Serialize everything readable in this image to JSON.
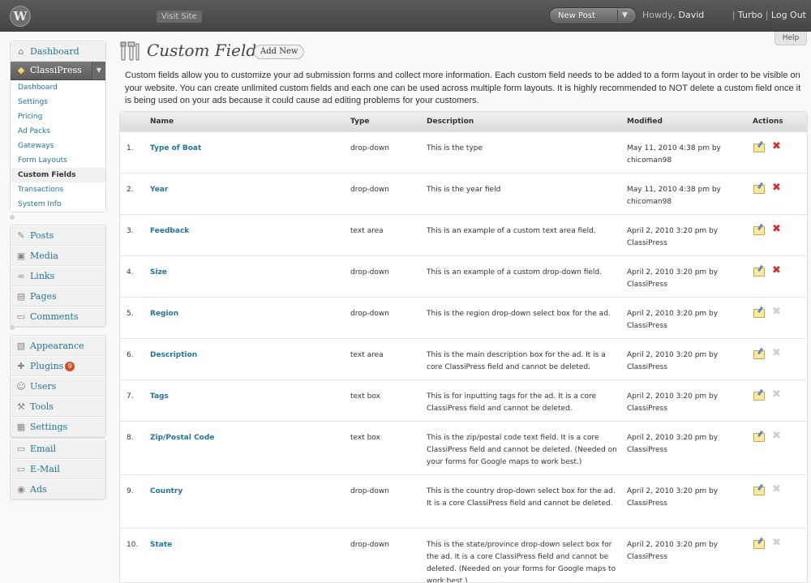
{
  "topbar": {
    "logo": "W",
    "visit_site": "Visit Site",
    "new_post": "New Post",
    "dropdown_arrow": "▼",
    "howdy_prefix": "Howdy, ",
    "user": "David",
    "turbo": "Turbo",
    "separator": "|",
    "logout": "Log Out"
  },
  "help": "Help",
  "sidebar": {
    "dashboard": {
      "label": "Dashboard",
      "icon": "dashboard-icon",
      "glyph": "⌂"
    },
    "classipress": {
      "label": "ClassiPress",
      "icon": "tag-icon",
      "glyph": "◆",
      "arrow": "▼",
      "items": [
        "Dashboard",
        "Settings",
        "Pricing",
        "Ad Packs",
        "Gateways",
        "Form Layouts",
        "Custom Fields",
        "Transactions",
        "System Info"
      ]
    },
    "group2": [
      {
        "label": "Posts",
        "icon": "pushpin-icon",
        "glyph": "✎"
      },
      {
        "label": "Media",
        "icon": "media-icon",
        "glyph": "▣"
      },
      {
        "label": "Links",
        "icon": "links-icon",
        "glyph": "∞"
      },
      {
        "label": "Pages",
        "icon": "pages-icon",
        "glyph": "▤"
      },
      {
        "label": "Comments",
        "icon": "comments-icon",
        "glyph": "▭"
      }
    ],
    "group3": [
      {
        "label": "Appearance",
        "icon": "appearance-icon",
        "glyph": "▧"
      },
      {
        "label": "Plugins",
        "icon": "plugins-icon",
        "glyph": "✚",
        "badge": "9"
      },
      {
        "label": "Users",
        "icon": "users-icon",
        "glyph": "☺"
      },
      {
        "label": "Tools",
        "icon": "tools-icon",
        "glyph": "⚒"
      },
      {
        "label": "Settings",
        "icon": "settings-icon",
        "glyph": "▦"
      }
    ],
    "group4": [
      {
        "label": "Email",
        "icon": "email-icon",
        "glyph": "▭"
      },
      {
        "label": "E-Mail",
        "icon": "email-icon",
        "glyph": "▭"
      },
      {
        "label": "Ads",
        "icon": "ads-icon",
        "glyph": "◉"
      }
    ]
  },
  "page": {
    "title": "Custom Fields",
    "add_new": "Add New",
    "intro": "Custom fields allow you to customize your ad submission forms and collect more information. Each custom field needs to be added to a form layout in order to be visible on your website. You can create unlimited custom fields and each one can be used across multiple form layouts. It is highly recommended to NOT delete a custom field once it is being used on your ads because it could cause ad editing problems for your customers."
  },
  "table": {
    "headers": {
      "name": "Name",
      "type": "Type",
      "description": "Description",
      "modified": "Modified",
      "actions": "Actions"
    },
    "rows": [
      {
        "num": "1.",
        "name": "Type of Boat",
        "type": "drop-down",
        "desc": "This is the type",
        "modified": "May 11, 2010 4:38 pm by chicoman98",
        "deletable": true
      },
      {
        "num": "2.",
        "name": "Year",
        "type": "drop-down",
        "desc": "This is the year field",
        "modified": "May 11, 2010 4:38 pm by chicoman98",
        "deletable": true
      },
      {
        "num": "3.",
        "name": "Feedback",
        "type": "text area",
        "desc": "This is an example of a custom text area field.",
        "modified": "April 2, 2010 3:20 pm by ClassiPress",
        "deletable": true
      },
      {
        "num": "4.",
        "name": "Size",
        "type": "drop-down",
        "desc": "This is an example of a custom drop-down field.",
        "modified": "April 2, 2010 3:20 pm by ClassiPress",
        "deletable": true
      },
      {
        "num": "5.",
        "name": "Region",
        "type": "drop-down",
        "desc": "This is the region drop-down select box for the ad.",
        "modified": "April 2, 2010 3:20 pm by ClassiPress",
        "deletable": false
      },
      {
        "num": "6.",
        "name": "Description",
        "type": "text area",
        "desc": "This is the main description box for the ad. It is a core ClassiPress field and cannot be deleted.",
        "modified": "April 2, 2010 3:20 pm by ClassiPress",
        "deletable": false
      },
      {
        "num": "7.",
        "name": "Tags",
        "type": "text box",
        "desc": "This is for inputting tags for the ad. It is a core ClassiPress field and cannot be deleted.",
        "modified": "April 2, 2010 3:20 pm by ClassiPress",
        "deletable": false
      },
      {
        "num": "8.",
        "name": "Zip/Postal Code",
        "type": "text box",
        "desc": "This is the zip/postal code text field. It is a core ClassiPress field and cannot be deleted. (Needed on your forms for Google maps to work best.)",
        "modified": "April 2, 2010 3:20 pm by ClassiPress",
        "deletable": false
      },
      {
        "num": "9.",
        "name": "Country",
        "type": "drop-down",
        "desc": "This is the country drop-down select box for the ad. It is a core ClassiPress field and cannot be deleted.",
        "modified": "April 2, 2010 3:20 pm by ClassiPress",
        "deletable": false
      },
      {
        "num": "10.",
        "name": "State",
        "type": "drop-down",
        "desc": "This is the state/province drop-down select box for the ad. It is a core ClassiPress field and cannot be deleted. (Needed on your forms for Google maps to work best.)",
        "modified": "April 2, 2010 3:20 pm by ClassiPress",
        "deletable": false
      }
    ],
    "delete_glyph": "✖"
  },
  "colors": {
    "link": "#21759b",
    "delete_active": "#d62f2f",
    "delete_disabled": "#cfcfcf"
  }
}
